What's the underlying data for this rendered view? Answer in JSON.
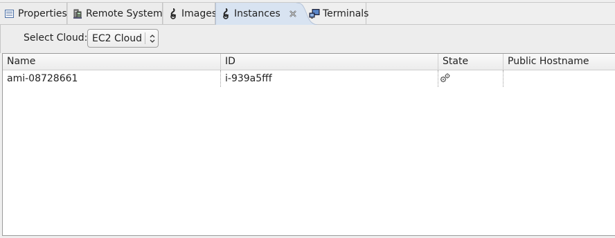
{
  "tabs": [
    {
      "label": "Properties",
      "icon": "properties-icon",
      "active": false
    },
    {
      "label": "Remote Systems",
      "icon": "remote-systems-icon",
      "active": false
    },
    {
      "label": "Images",
      "icon": "cloud-images-icon",
      "active": false
    },
    {
      "label": "Instances",
      "icon": "cloud-instances-icon",
      "active": true
    },
    {
      "label": "Terminals",
      "icon": "terminals-icon",
      "active": false
    }
  ],
  "toolbar": {
    "select_label": "Select Cloud:",
    "select_value": "EC2 Cloud"
  },
  "table": {
    "columns": [
      "Name",
      "ID",
      "State",
      "Public Hostname"
    ],
    "rows": [
      {
        "name": "ami-08728661",
        "id": "i-939a5fff",
        "state_icon": "running-gears-icon",
        "public_hostname": ""
      }
    ]
  },
  "colors": {
    "active_tab": "#d8e3f1",
    "toolbar_bg": "#ededed"
  }
}
